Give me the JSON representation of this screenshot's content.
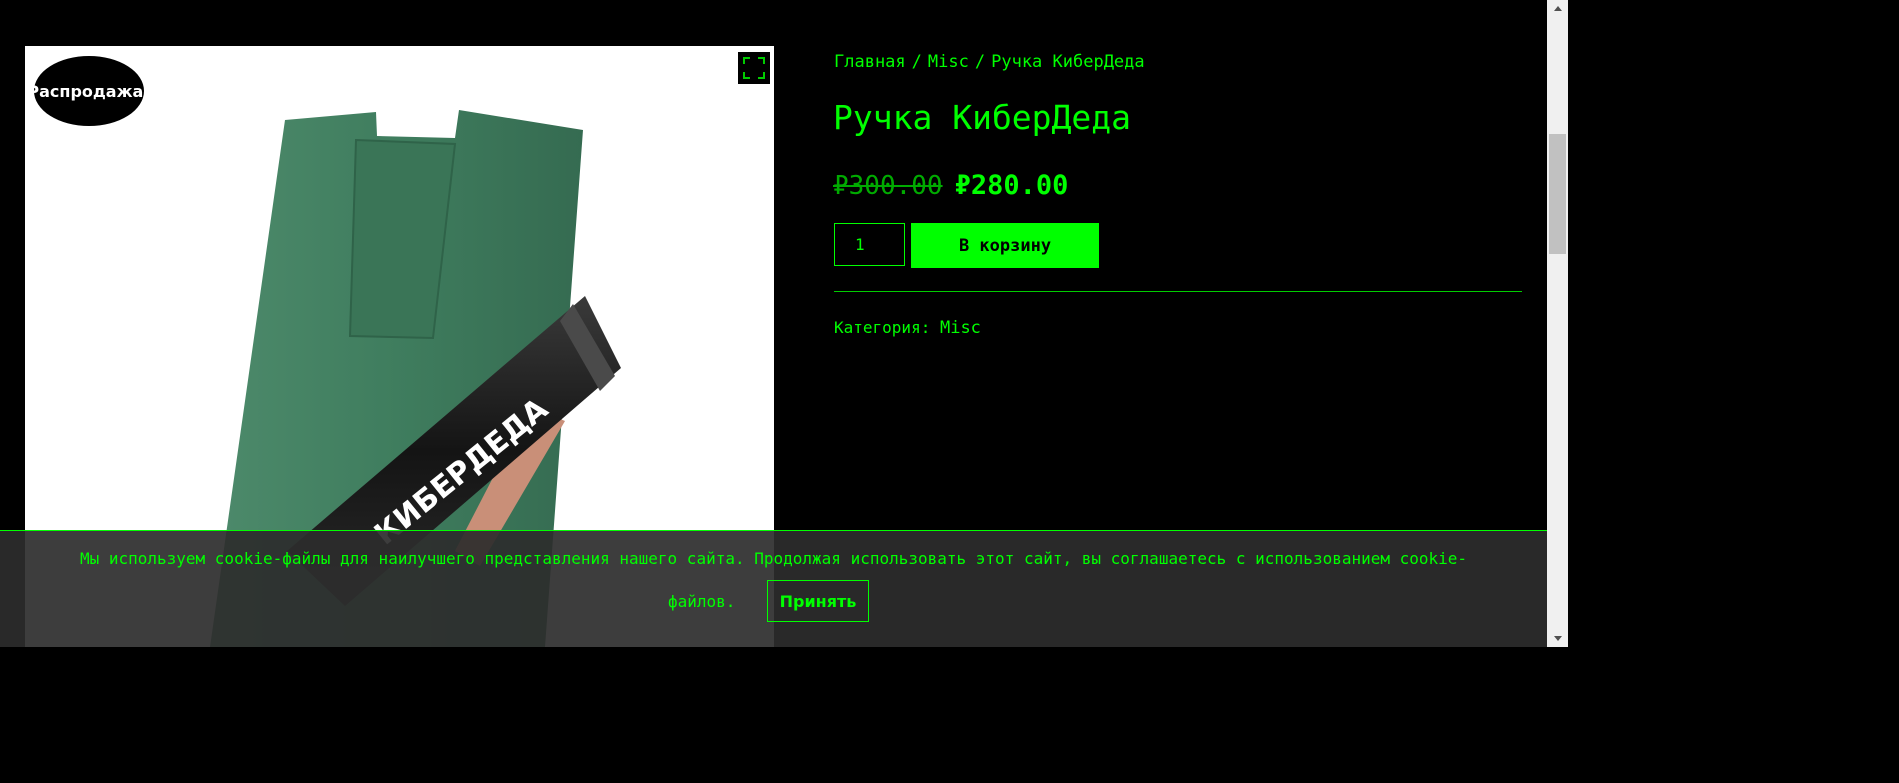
{
  "gallery": {
    "sale_badge": "Распродажа!",
    "zoom_icon": "fullscreen-icon",
    "pen_print": "КИБЕРДЕДА"
  },
  "breadcrumb": {
    "items": [
      "Главная",
      "Misc",
      "Ручка КиберДеда"
    ],
    "separator": "/"
  },
  "product": {
    "title": "Ручка КиберДеда",
    "price_old": "₽300.00",
    "price_new": "₽280.00",
    "quantity": "1",
    "add_to_cart_label": "В корзину",
    "category_label": "Категория:",
    "category_value": "Misc"
  },
  "cookie": {
    "text_line1": "Мы используем cookie-файлы для наилучшего представления нашего сайта. Продолжая использовать этот сайт, вы соглашаетесь с использованием cookie-",
    "text_line2": "файлов.",
    "accept_label": "Принять"
  },
  "colors": {
    "background": "#000000",
    "accent": "#00ff00",
    "accent_dim": "#00aa00",
    "cookie_bar": "#2d2d2d",
    "sleeve": "#3d7a5c",
    "pen": "#1c1c1c"
  },
  "icons": {
    "scroll_up": "triangle-up-icon",
    "scroll_down": "triangle-down-icon"
  }
}
